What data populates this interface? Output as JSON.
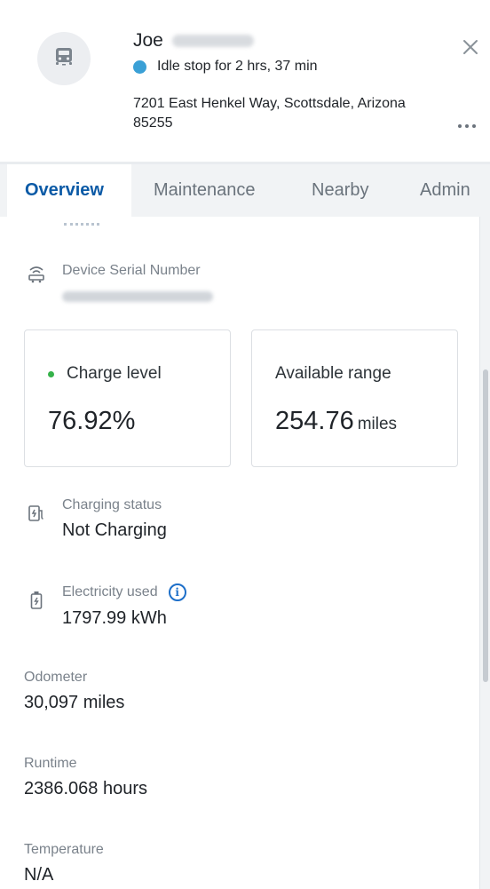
{
  "driver": {
    "first_name": "Joe",
    "status_text": "Idle stop for 2 hrs, 37 min",
    "status_color": "#3aa0d6",
    "address": "7201 East Henkel Way, Scottsdale, Arizona 85255"
  },
  "icons": {
    "avatar": "car-icon",
    "close": "close-icon",
    "more": "more-icon"
  },
  "tabs": [
    {
      "label": "Overview",
      "active": true
    },
    {
      "label": "Maintenance",
      "active": false
    },
    {
      "label": "Nearby",
      "active": false
    },
    {
      "label": "Admin",
      "active": false
    }
  ],
  "device": {
    "label": "Device Serial Number"
  },
  "cards": {
    "charge": {
      "label": "Charge level",
      "value": "76.92%"
    },
    "range": {
      "label": "Available range",
      "value": "254.76",
      "unit": "miles"
    }
  },
  "charging": {
    "label": "Charging status",
    "value": "Not Charging"
  },
  "electricity": {
    "label": "Electricity used",
    "value": "1797.99 kWh"
  },
  "odometer": {
    "label": "Odometer",
    "value": "30,097 miles"
  },
  "runtime": {
    "label": "Runtime",
    "value": "2386.068 hours"
  },
  "temperature": {
    "label": "Temperature",
    "value": "N/A"
  },
  "colors": {
    "accent": "#0b5aa6",
    "charge_dot": "#35b24a",
    "info": "#1d6fc9"
  }
}
